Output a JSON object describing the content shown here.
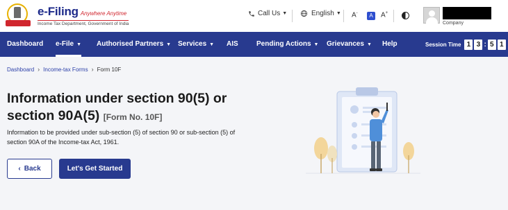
{
  "header": {
    "brand_name": "e-Filing",
    "brand_tagline": "Anywhere Anytime",
    "brand_subtitle": "Income Tax Department, Government of India",
    "call_us": "Call Us",
    "language": "English",
    "font_small": "A",
    "font_normal": "A",
    "font_large": "A",
    "user_subtitle": "Company",
    "icons": {
      "call": "phone-icon",
      "language": "globe-icon",
      "contrast": "contrast-icon",
      "avatar": "user-avatar-icon"
    }
  },
  "nav": {
    "items": [
      {
        "label": "Dashboard",
        "has_menu": false
      },
      {
        "label": "e-File",
        "has_menu": true,
        "active": true
      },
      {
        "label": "Authorised Partners",
        "has_menu": true
      },
      {
        "label": "Services",
        "has_menu": true
      },
      {
        "label": "AIS",
        "has_menu": false
      },
      {
        "label": "Pending Actions",
        "has_menu": true
      },
      {
        "label": "Grievances",
        "has_menu": true
      },
      {
        "label": "Help",
        "has_menu": false
      }
    ],
    "session_label": "Session Time",
    "session_digits": [
      "1",
      "3",
      "5",
      "1"
    ]
  },
  "breadcrumb": {
    "items": [
      "Dashboard",
      "Income-tax Forms"
    ],
    "current": "Form 10F"
  },
  "main": {
    "title": "Information under section 90(5) or section 90A(5)",
    "form_no": "[Form No. 10F]",
    "description": "Information to be provided under sub-section (5) of section 90 or sub-section (5) of section 90A of the Income-tax Act, 1961.",
    "back_label": "Back",
    "start_label": "Let's Get Started"
  },
  "colors": {
    "nav_bg": "#283a8f",
    "page_bg": "#f4f5f8",
    "primary_button": "#283a8f",
    "link": "#2b3fa8"
  }
}
